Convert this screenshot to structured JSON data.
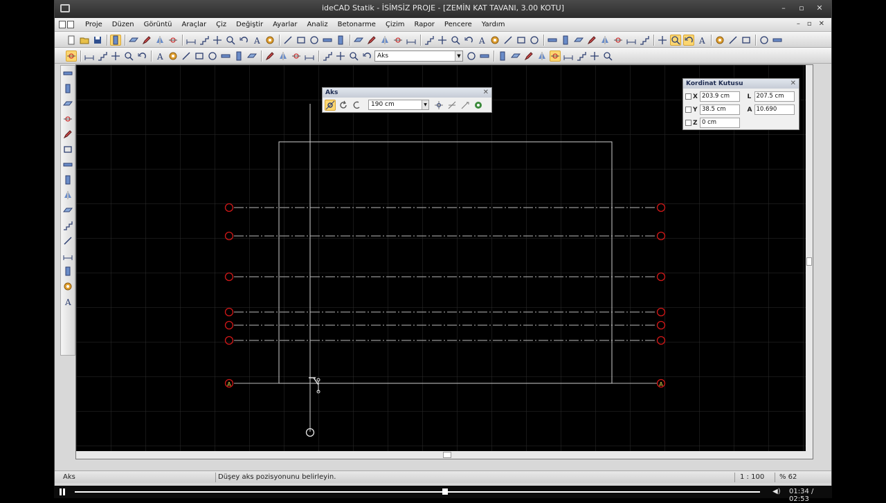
{
  "titlebar": {
    "title": "ideCAD Statik - İSİMSİZ PROJE - [ZEMİN KAT TAVANI,  3.00 KOTU]",
    "minimize": "–",
    "maximize": "▫",
    "close": "✕"
  },
  "menu": {
    "items": [
      "Proje",
      "Düzen",
      "Görüntü",
      "Araçlar",
      "Çiz",
      "Değiştir",
      "Ayarlar",
      "Analiz",
      "Betonarme",
      "Çizim",
      "Rapor",
      "Pencere",
      "Yardım"
    ],
    "mdi_minimize": "–",
    "mdi_restore": "▫",
    "mdi_close": "✕"
  },
  "toolbar2": {
    "layer_value": "Aks"
  },
  "aks_panel": {
    "title": "Aks",
    "close": "✕",
    "distance_value": "190 cm"
  },
  "kordinat": {
    "title": "Kordinat Kutusu",
    "close": "✕",
    "x_label": "X",
    "x_value": "203.9 cm",
    "l_label": "L",
    "l_value": "207.5 cm",
    "y_label": "Y",
    "y_value": "38.5 cm",
    "a_label": "A",
    "a_value": "10.690",
    "z_label": "Z",
    "z_value": "0 cm"
  },
  "drawing": {
    "axis_label_left": "A",
    "axis_label_right": "A",
    "line_color": "#bdbdbd",
    "bubble_color": "#d01818",
    "label_color": "#e8d84a"
  },
  "statusbar": {
    "mode": "Aks",
    "prompt": "Düşey aks pozisyonunu belirleyin.",
    "scale": "1 : 100",
    "zoom": "% 62"
  },
  "player": {
    "time": "01:34 / 02:53",
    "progress": 0.54
  }
}
